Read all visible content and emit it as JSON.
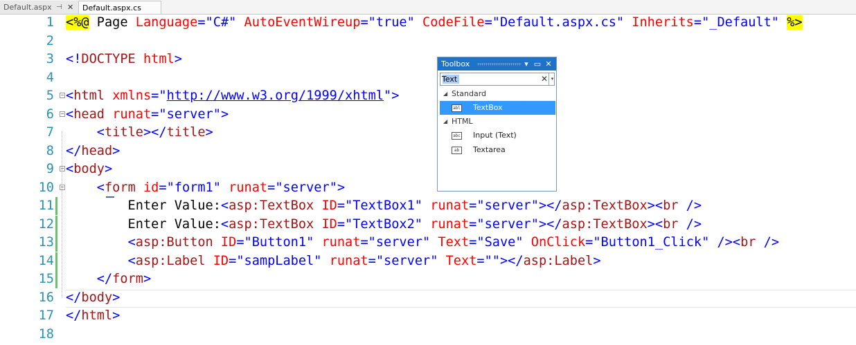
{
  "tabs": [
    {
      "label": "Default.aspx",
      "pin_glyph": "⊣",
      "close_glyph": "✕"
    },
    {
      "label": "Default.aspx.cs"
    }
  ],
  "editor": {
    "lines": [
      {
        "number": "1",
        "tokens": [
          {
            "c": "dir",
            "t": "<%@"
          },
          {
            "c": "text",
            "t": " Page "
          },
          {
            "c": "attr",
            "t": "Language"
          },
          {
            "c": "delim",
            "t": "="
          },
          {
            "c": "val",
            "t": "\"C#\""
          },
          {
            "c": "text",
            "t": " "
          },
          {
            "c": "attr",
            "t": "AutoEventWireup"
          },
          {
            "c": "delim",
            "t": "="
          },
          {
            "c": "val",
            "t": "\"true\""
          },
          {
            "c": "text",
            "t": " "
          },
          {
            "c": "attr",
            "t": "CodeFile"
          },
          {
            "c": "delim",
            "t": "="
          },
          {
            "c": "val",
            "t": "\"Default.aspx.cs\""
          },
          {
            "c": "text",
            "t": " "
          },
          {
            "c": "attr",
            "t": "Inherits"
          },
          {
            "c": "delim",
            "t": "="
          },
          {
            "c": "val",
            "t": "\"_Default\""
          },
          {
            "c": "text",
            "t": " "
          },
          {
            "c": "dir",
            "t": "%>"
          }
        ]
      },
      {
        "number": "2",
        "tokens": []
      },
      {
        "number": "3",
        "tokens": [
          {
            "c": "delim",
            "t": "<!"
          },
          {
            "c": "tag",
            "t": "DOCTYPE"
          },
          {
            "c": "text",
            "t": " "
          },
          {
            "c": "attr",
            "t": "html"
          },
          {
            "c": "delim",
            "t": ">"
          }
        ]
      },
      {
        "number": "4",
        "tokens": []
      },
      {
        "number": "5",
        "fold": "⊟",
        "tokens": [
          {
            "c": "delim",
            "t": "<"
          },
          {
            "c": "tag",
            "t": "html"
          },
          {
            "c": "text",
            "t": " "
          },
          {
            "c": "attr",
            "t": "xmlns"
          },
          {
            "c": "delim",
            "t": "="
          },
          {
            "c": "val",
            "t": "\""
          },
          {
            "c": "url",
            "t": "http://www.w3.org/1999/xhtml"
          },
          {
            "c": "val",
            "t": "\""
          },
          {
            "c": "delim",
            "t": ">"
          }
        ]
      },
      {
        "number": "6",
        "fold": "⊟",
        "tokens": [
          {
            "c": "delim",
            "t": "<"
          },
          {
            "c": "tag",
            "t": "head"
          },
          {
            "c": "text",
            "t": " "
          },
          {
            "c": "attr",
            "t": "runat"
          },
          {
            "c": "delim",
            "t": "="
          },
          {
            "c": "val",
            "t": "\"server\""
          },
          {
            "c": "delim",
            "t": ">"
          }
        ]
      },
      {
        "number": "7",
        "tokens": [
          {
            "c": "text",
            "t": "    "
          },
          {
            "c": "delim",
            "t": "<"
          },
          {
            "c": "tag",
            "t": "title"
          },
          {
            "c": "delim",
            "t": "></"
          },
          {
            "c": "tag",
            "t": "title"
          },
          {
            "c": "delim",
            "t": ">"
          }
        ]
      },
      {
        "number": "8",
        "tokens": [
          {
            "c": "delim",
            "t": "</"
          },
          {
            "c": "tag",
            "t": "head"
          },
          {
            "c": "delim",
            "t": ">"
          }
        ]
      },
      {
        "number": "9",
        "fold": "⊟",
        "tokens": [
          {
            "c": "delim",
            "t": "<"
          },
          {
            "c": "tag",
            "t": "body"
          },
          {
            "c": "delim",
            "t": ">"
          }
        ]
      },
      {
        "number": "10",
        "fold": "⊟",
        "tokens": [
          {
            "c": "text",
            "t": "    "
          },
          {
            "c": "delim",
            "t": "<"
          },
          {
            "c": "tag",
            "t": "form"
          },
          {
            "c": "text",
            "t": " "
          },
          {
            "c": "attr",
            "t": "id"
          },
          {
            "c": "delim",
            "t": "="
          },
          {
            "c": "val",
            "t": "\"form1\""
          },
          {
            "c": "text",
            "t": " "
          },
          {
            "c": "attr",
            "t": "runat"
          },
          {
            "c": "delim",
            "t": "="
          },
          {
            "c": "val",
            "t": "\"server\""
          },
          {
            "c": "delim",
            "t": ">"
          }
        ]
      },
      {
        "number": "11",
        "changed": true,
        "tokens": [
          {
            "c": "text",
            "t": "        Enter Value:"
          },
          {
            "c": "delim",
            "t": "<"
          },
          {
            "c": "tag",
            "t": "asp:TextBox"
          },
          {
            "c": "text",
            "t": " "
          },
          {
            "c": "attr",
            "t": "ID"
          },
          {
            "c": "delim",
            "t": "="
          },
          {
            "c": "val",
            "t": "\"TextBox1\""
          },
          {
            "c": "text",
            "t": " "
          },
          {
            "c": "attr",
            "t": "runat"
          },
          {
            "c": "delim",
            "t": "="
          },
          {
            "c": "val",
            "t": "\"server\""
          },
          {
            "c": "delim",
            "t": "></"
          },
          {
            "c": "tag",
            "t": "asp:TextBox"
          },
          {
            "c": "delim",
            "t": "><"
          },
          {
            "c": "tag",
            "t": "br"
          },
          {
            "c": "text",
            "t": " "
          },
          {
            "c": "delim",
            "t": "/>"
          }
        ]
      },
      {
        "number": "12",
        "changed": true,
        "tokens": [
          {
            "c": "text",
            "t": "        Enter Value:"
          },
          {
            "c": "delim",
            "t": "<"
          },
          {
            "c": "tag",
            "t": "asp:TextBox"
          },
          {
            "c": "text",
            "t": " "
          },
          {
            "c": "attr",
            "t": "ID"
          },
          {
            "c": "delim",
            "t": "="
          },
          {
            "c": "val",
            "t": "\"TextBox2\""
          },
          {
            "c": "text",
            "t": " "
          },
          {
            "c": "attr",
            "t": "runat"
          },
          {
            "c": "delim",
            "t": "="
          },
          {
            "c": "val",
            "t": "\"server\""
          },
          {
            "c": "delim",
            "t": "></"
          },
          {
            "c": "tag",
            "t": "asp:TextBox"
          },
          {
            "c": "delim",
            "t": "><"
          },
          {
            "c": "tag",
            "t": "br"
          },
          {
            "c": "text",
            "t": " "
          },
          {
            "c": "delim",
            "t": "/>"
          }
        ]
      },
      {
        "number": "13",
        "changed": true,
        "tokens": [
          {
            "c": "text",
            "t": "        "
          },
          {
            "c": "delim",
            "t": "<"
          },
          {
            "c": "tag",
            "t": "asp:Button"
          },
          {
            "c": "text",
            "t": " "
          },
          {
            "c": "attr",
            "t": "ID"
          },
          {
            "c": "delim",
            "t": "="
          },
          {
            "c": "val",
            "t": "\"Button1\""
          },
          {
            "c": "text",
            "t": " "
          },
          {
            "c": "attr",
            "t": "runat"
          },
          {
            "c": "delim",
            "t": "="
          },
          {
            "c": "val",
            "t": "\"server\""
          },
          {
            "c": "text",
            "t": " "
          },
          {
            "c": "attr",
            "t": "Text"
          },
          {
            "c": "delim",
            "t": "="
          },
          {
            "c": "val",
            "t": "\"Save\""
          },
          {
            "c": "text",
            "t": " "
          },
          {
            "c": "attr",
            "t": "OnClick"
          },
          {
            "c": "delim",
            "t": "="
          },
          {
            "c": "val",
            "t": "\"Button1_Click\""
          },
          {
            "c": "text",
            "t": " "
          },
          {
            "c": "delim",
            "t": "/><"
          },
          {
            "c": "tag",
            "t": "br"
          },
          {
            "c": "text",
            "t": " "
          },
          {
            "c": "delim",
            "t": "/>"
          }
        ]
      },
      {
        "number": "14",
        "changed": true,
        "tokens": [
          {
            "c": "text",
            "t": "        "
          },
          {
            "c": "delim",
            "t": "<"
          },
          {
            "c": "tag",
            "t": "asp:Label"
          },
          {
            "c": "text",
            "t": " "
          },
          {
            "c": "attr",
            "t": "ID"
          },
          {
            "c": "delim",
            "t": "="
          },
          {
            "c": "val",
            "t": "\"sampLabel\""
          },
          {
            "c": "text",
            "t": " "
          },
          {
            "c": "attr",
            "t": "runat"
          },
          {
            "c": "delim",
            "t": "="
          },
          {
            "c": "val",
            "t": "\"server\""
          },
          {
            "c": "text",
            "t": " "
          },
          {
            "c": "attr",
            "t": "Text"
          },
          {
            "c": "delim",
            "t": "="
          },
          {
            "c": "val",
            "t": "\"\""
          },
          {
            "c": "delim",
            "t": "></"
          },
          {
            "c": "tag",
            "t": "asp:Label"
          },
          {
            "c": "delim",
            "t": ">"
          }
        ]
      },
      {
        "number": "15",
        "changed": true,
        "tokens": [
          {
            "c": "text",
            "t": "    "
          },
          {
            "c": "delim",
            "t": "</"
          },
          {
            "c": "tag",
            "t": "form"
          },
          {
            "c": "delim",
            "t": ">"
          }
        ]
      },
      {
        "number": "16",
        "tokens": [
          {
            "c": "delim",
            "t": "</"
          },
          {
            "c": "tag",
            "t": "body"
          },
          {
            "c": "delim",
            "t": ">"
          }
        ]
      },
      {
        "number": "17",
        "tokens": [
          {
            "c": "delim",
            "t": "</"
          },
          {
            "c": "tag",
            "t": "html"
          },
          {
            "c": "delim",
            "t": ">"
          }
        ]
      },
      {
        "number": "18",
        "tokens": []
      }
    ]
  },
  "toolbox": {
    "title": "Toolbox",
    "buttons": {
      "dropdown": "▾",
      "pin": "▭",
      "close": "✕"
    },
    "search": {
      "value": "Text",
      "clear_glyph": "✕",
      "drop_glyph": "▾"
    },
    "groups": [
      {
        "label": "Standard",
        "expander": "◢",
        "items": [
          {
            "label": "TextBox",
            "icon": "textbox-icon",
            "icon_text": "abl",
            "selected": true
          }
        ]
      },
      {
        "label": "HTML",
        "expander": "◢",
        "items": [
          {
            "label": "Input (Text)",
            "icon": "input-text-icon",
            "icon_text": "abc",
            "selected": false
          },
          {
            "label": "Textarea",
            "icon": "textarea-icon",
            "icon_text": "ab",
            "selected": false
          }
        ]
      }
    ]
  },
  "colors": {
    "accent": "#1e73c8",
    "selection": "#3399ff",
    "line_number": "#2b91af",
    "tag": "#a31515",
    "attribute": "#ff0000",
    "value": "#0000ff",
    "change_bar": "#6cbe6c"
  }
}
